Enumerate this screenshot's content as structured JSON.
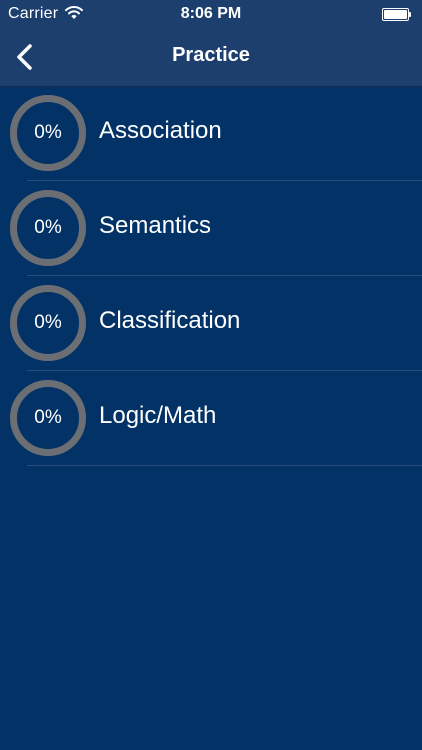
{
  "status_bar": {
    "carrier": "Carrier",
    "time": "8:06 PM"
  },
  "nav": {
    "title": "Practice",
    "back_icon": "chevron-left-icon"
  },
  "categories": [
    {
      "label": "Association",
      "progress": "0%"
    },
    {
      "label": "Semantics",
      "progress": "0%"
    },
    {
      "label": "Classification",
      "progress": "0%"
    },
    {
      "label": "Logic/Math",
      "progress": "0%"
    }
  ],
  "colors": {
    "background": "#033366",
    "navbar": "#1c3f6e",
    "ring": "#6b6f74",
    "separator": "#2a4e7b"
  }
}
